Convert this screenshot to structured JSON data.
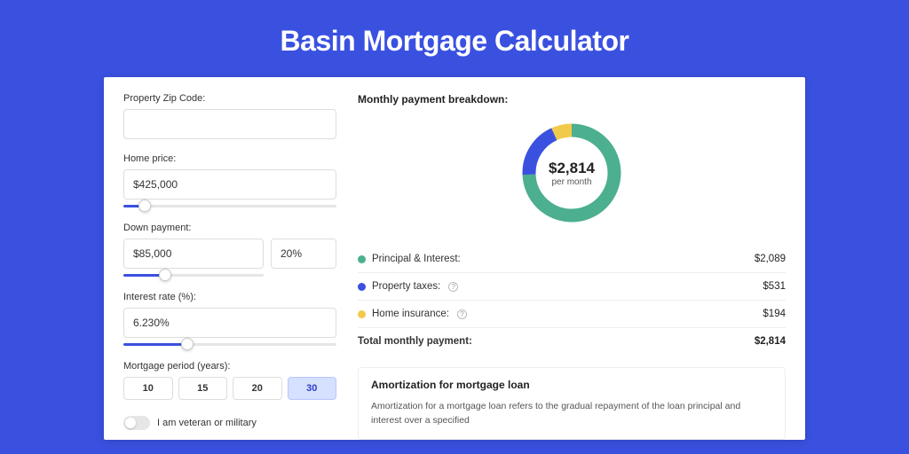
{
  "title": "Basin Mortgage Calculator",
  "form": {
    "zip_label": "Property Zip Code:",
    "zip_value": "",
    "price_label": "Home price:",
    "price_value": "$425,000",
    "down_label": "Down payment:",
    "down_value": "$85,000",
    "down_pct": "20%",
    "rate_label": "Interest rate (%):",
    "rate_value": "6.230%",
    "period_label": "Mortgage period (years):",
    "periods": [
      "10",
      "15",
      "20",
      "30"
    ],
    "period_selected": "30",
    "veteran_label": "I am veteran or military"
  },
  "breakdown": {
    "title": "Monthly payment breakdown:",
    "center_value": "$2,814",
    "center_sub": "per month",
    "rows": [
      {
        "label": "Principal & Interest:",
        "value": "$2,089",
        "help": false
      },
      {
        "label": "Property taxes:",
        "value": "$531",
        "help": true
      },
      {
        "label": "Home insurance:",
        "value": "$194",
        "help": true
      }
    ],
    "total_label": "Total monthly payment:",
    "total_value": "$2,814"
  },
  "amort": {
    "title": "Amortization for mortgage loan",
    "text": "Amortization for a mortgage loan refers to the gradual repayment of the loan principal and interest over a specified"
  },
  "chart_data": {
    "type": "pie",
    "title": "Monthly payment breakdown",
    "series": [
      {
        "name": "Principal & Interest",
        "value": 2089,
        "color": "#4caf8f"
      },
      {
        "name": "Property taxes",
        "value": 531,
        "color": "#3a51e0"
      },
      {
        "name": "Home insurance",
        "value": 194,
        "color": "#f1c94b"
      }
    ],
    "total": 2814
  }
}
